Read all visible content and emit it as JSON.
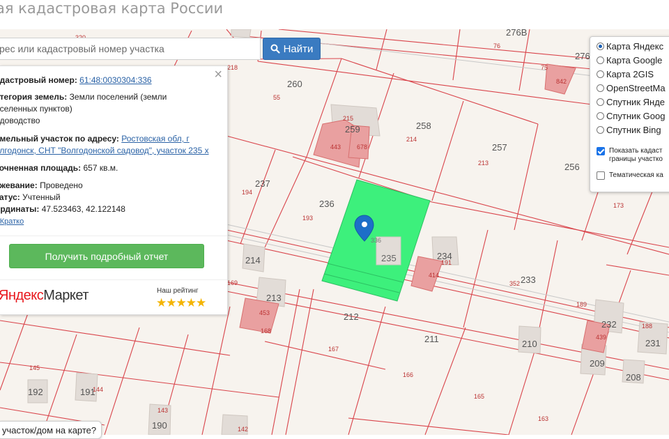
{
  "page": {
    "title": "ая кадастровая карта России"
  },
  "search": {
    "placeholder": "рес или кадастровый номер участка",
    "button_label": "Найти"
  },
  "info": {
    "cadastral_label": "адастровый номер:",
    "cadastral_value": "61:48:0030304:336",
    "category_label": "атегория земель:",
    "category_value_1": "Земли поселений (земли",
    "category_value_2": "аселенных пунктов)",
    "category_value_3": "адоводство",
    "address_label": "емельный участок по адресу:",
    "address_value_1": "Ростовская обл, г",
    "address_value_2": "олгодонск, СНТ \"Волгодонской садовод\", участок 235 х",
    "area_label": "точненная площадь:",
    "area_value": "657 кв.м.",
    "survey_label": "ежевание:",
    "survey_value": "Проведено",
    "status_label": "татус:",
    "status_value": "Учтенный",
    "coords_label": "ординаты:",
    "coords_value": "47.523463, 42.122148",
    "brief_link": "- Кратко",
    "report_button": "Получить подробный отчет",
    "market_ya": "Яндекс",
    "market_word": "Маркет",
    "rating_label": "Наш рейтинг",
    "stars": "★★★★★"
  },
  "layers": {
    "base": [
      {
        "label": "Карта Яндекс",
        "selected": true
      },
      {
        "label": "Карта Google",
        "selected": false
      },
      {
        "label": "Карта 2GIS",
        "selected": false
      },
      {
        "label": "OpenStreetMa",
        "selected": false
      },
      {
        "label": "Спутник Янде",
        "selected": false
      },
      {
        "label": "Спутник Goog",
        "selected": false
      },
      {
        "label": "Спутник Bing",
        "selected": false
      }
    ],
    "show_borders_1": "Показать кадаст",
    "show_borders_2": "границы участко",
    "show_borders_checked": true,
    "thematic": "Тематическая ка",
    "thematic_checked": false
  },
  "popup": {
    "text": "участок/дом на карте?"
  },
  "map": {
    "selected_color": "#3df07c",
    "border_color": "#d9434a",
    "building_color": "#e9a0a0",
    "plot_numbers": [
      "276В",
      "76",
      "276",
      "260",
      "55",
      "218",
      "320",
      "75",
      "842",
      "215",
      "259",
      "443",
      "678",
      "258",
      "214",
      "257",
      "213",
      "256",
      "173",
      "237",
      "194",
      "236",
      "193",
      "336",
      "235",
      "234",
      "191",
      "414",
      "233",
      "352",
      "214",
      "169",
      "213",
      "453",
      "168",
      "189",
      "232",
      "439",
      "188",
      "212",
      "167",
      "211",
      "210",
      "209",
      "231",
      "208",
      "145",
      "192",
      "191",
      "144",
      "166",
      "165",
      "143",
      "190",
      "142",
      "163"
    ]
  }
}
